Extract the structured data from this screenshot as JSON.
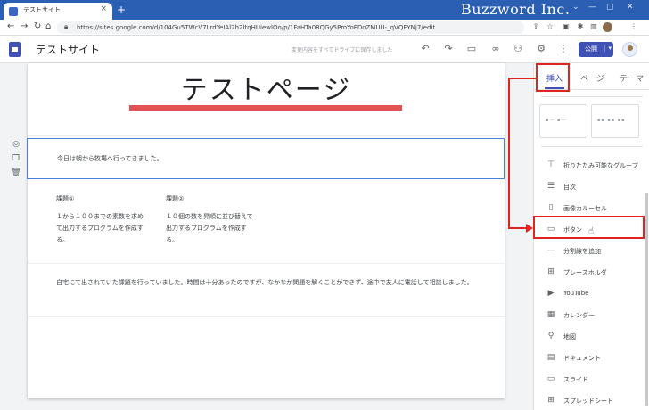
{
  "browser": {
    "tab_title": "テストサイト",
    "tab_close": "×",
    "new_tab": "+",
    "url": "https://sites.google.com/d/104Gu5TWcV7LrdYeIAl2h2ltqHUiewlOo/p/1FaHTa08QGy5PmYoFDoZMUU-_qVQFYNj7/edit",
    "watermark": "Buzzword Inc.",
    "window_controls": [
      "⌄",
      "—",
      "▢",
      "✕"
    ]
  },
  "toolbar": {
    "site_name": "テストサイト",
    "save_status": "変更内容をすべてドライブに保存しました",
    "publish_label": "公開",
    "publish_caret": "▾"
  },
  "page": {
    "title": "テストページ",
    "paragraph1": "今日は朝から牧場へ行ってきました。",
    "task1_heading": "課題①",
    "task1_body": "１から１００までの素数を求めて出力するプログラムを作成する。",
    "task2_heading": "課題②",
    "task2_body": "１０個の数を昇順に並び替えて出力するプログラムを作成する。",
    "paragraph2": "自宅にて出されていた課題を行っていました。時間は十分あったのですが、なかなか問題を解くことができず、途中で友人に電話して相談しました。"
  },
  "panel": {
    "tabs": [
      {
        "label": "挿入",
        "active": true
      },
      {
        "label": "ページ",
        "active": false
      },
      {
        "label": "テーマ",
        "active": false
      }
    ],
    "items": [
      {
        "label": "折りたたみ可能なグループ",
        "icon": "collapsible-group-icon",
        "glyph": "⊤"
      },
      {
        "label": "目次",
        "icon": "table-of-contents-icon",
        "glyph": "☰"
      },
      {
        "label": "画像カルーセル",
        "icon": "image-carousel-icon",
        "glyph": "▯"
      },
      {
        "label": "ボタン",
        "icon": "button-icon",
        "glyph": "▭"
      },
      {
        "label": "分割線を追加",
        "icon": "divider-icon",
        "glyph": "—"
      },
      {
        "label": "プレースホルダ",
        "icon": "placeholder-icon",
        "glyph": "⊞"
      },
      {
        "label": "YouTube",
        "icon": "youtube-icon",
        "glyph": "▶"
      },
      {
        "label": "カレンダー",
        "icon": "calendar-icon",
        "glyph": "▦"
      },
      {
        "label": "地図",
        "icon": "map-pin-icon",
        "glyph": "⚲"
      },
      {
        "label": "ドキュメント",
        "icon": "docs-icon",
        "glyph": "▤"
      },
      {
        "label": "スライド",
        "icon": "slides-icon",
        "glyph": "▭"
      },
      {
        "label": "スプレッドシート",
        "icon": "sheets-icon",
        "glyph": "⊞"
      }
    ]
  },
  "colors": {
    "accent": "#3f51b5",
    "title_underline": "#e35252",
    "selection": "#4a80e0",
    "annotation": "#e02424",
    "tab_bar": "#2a5fb3"
  }
}
